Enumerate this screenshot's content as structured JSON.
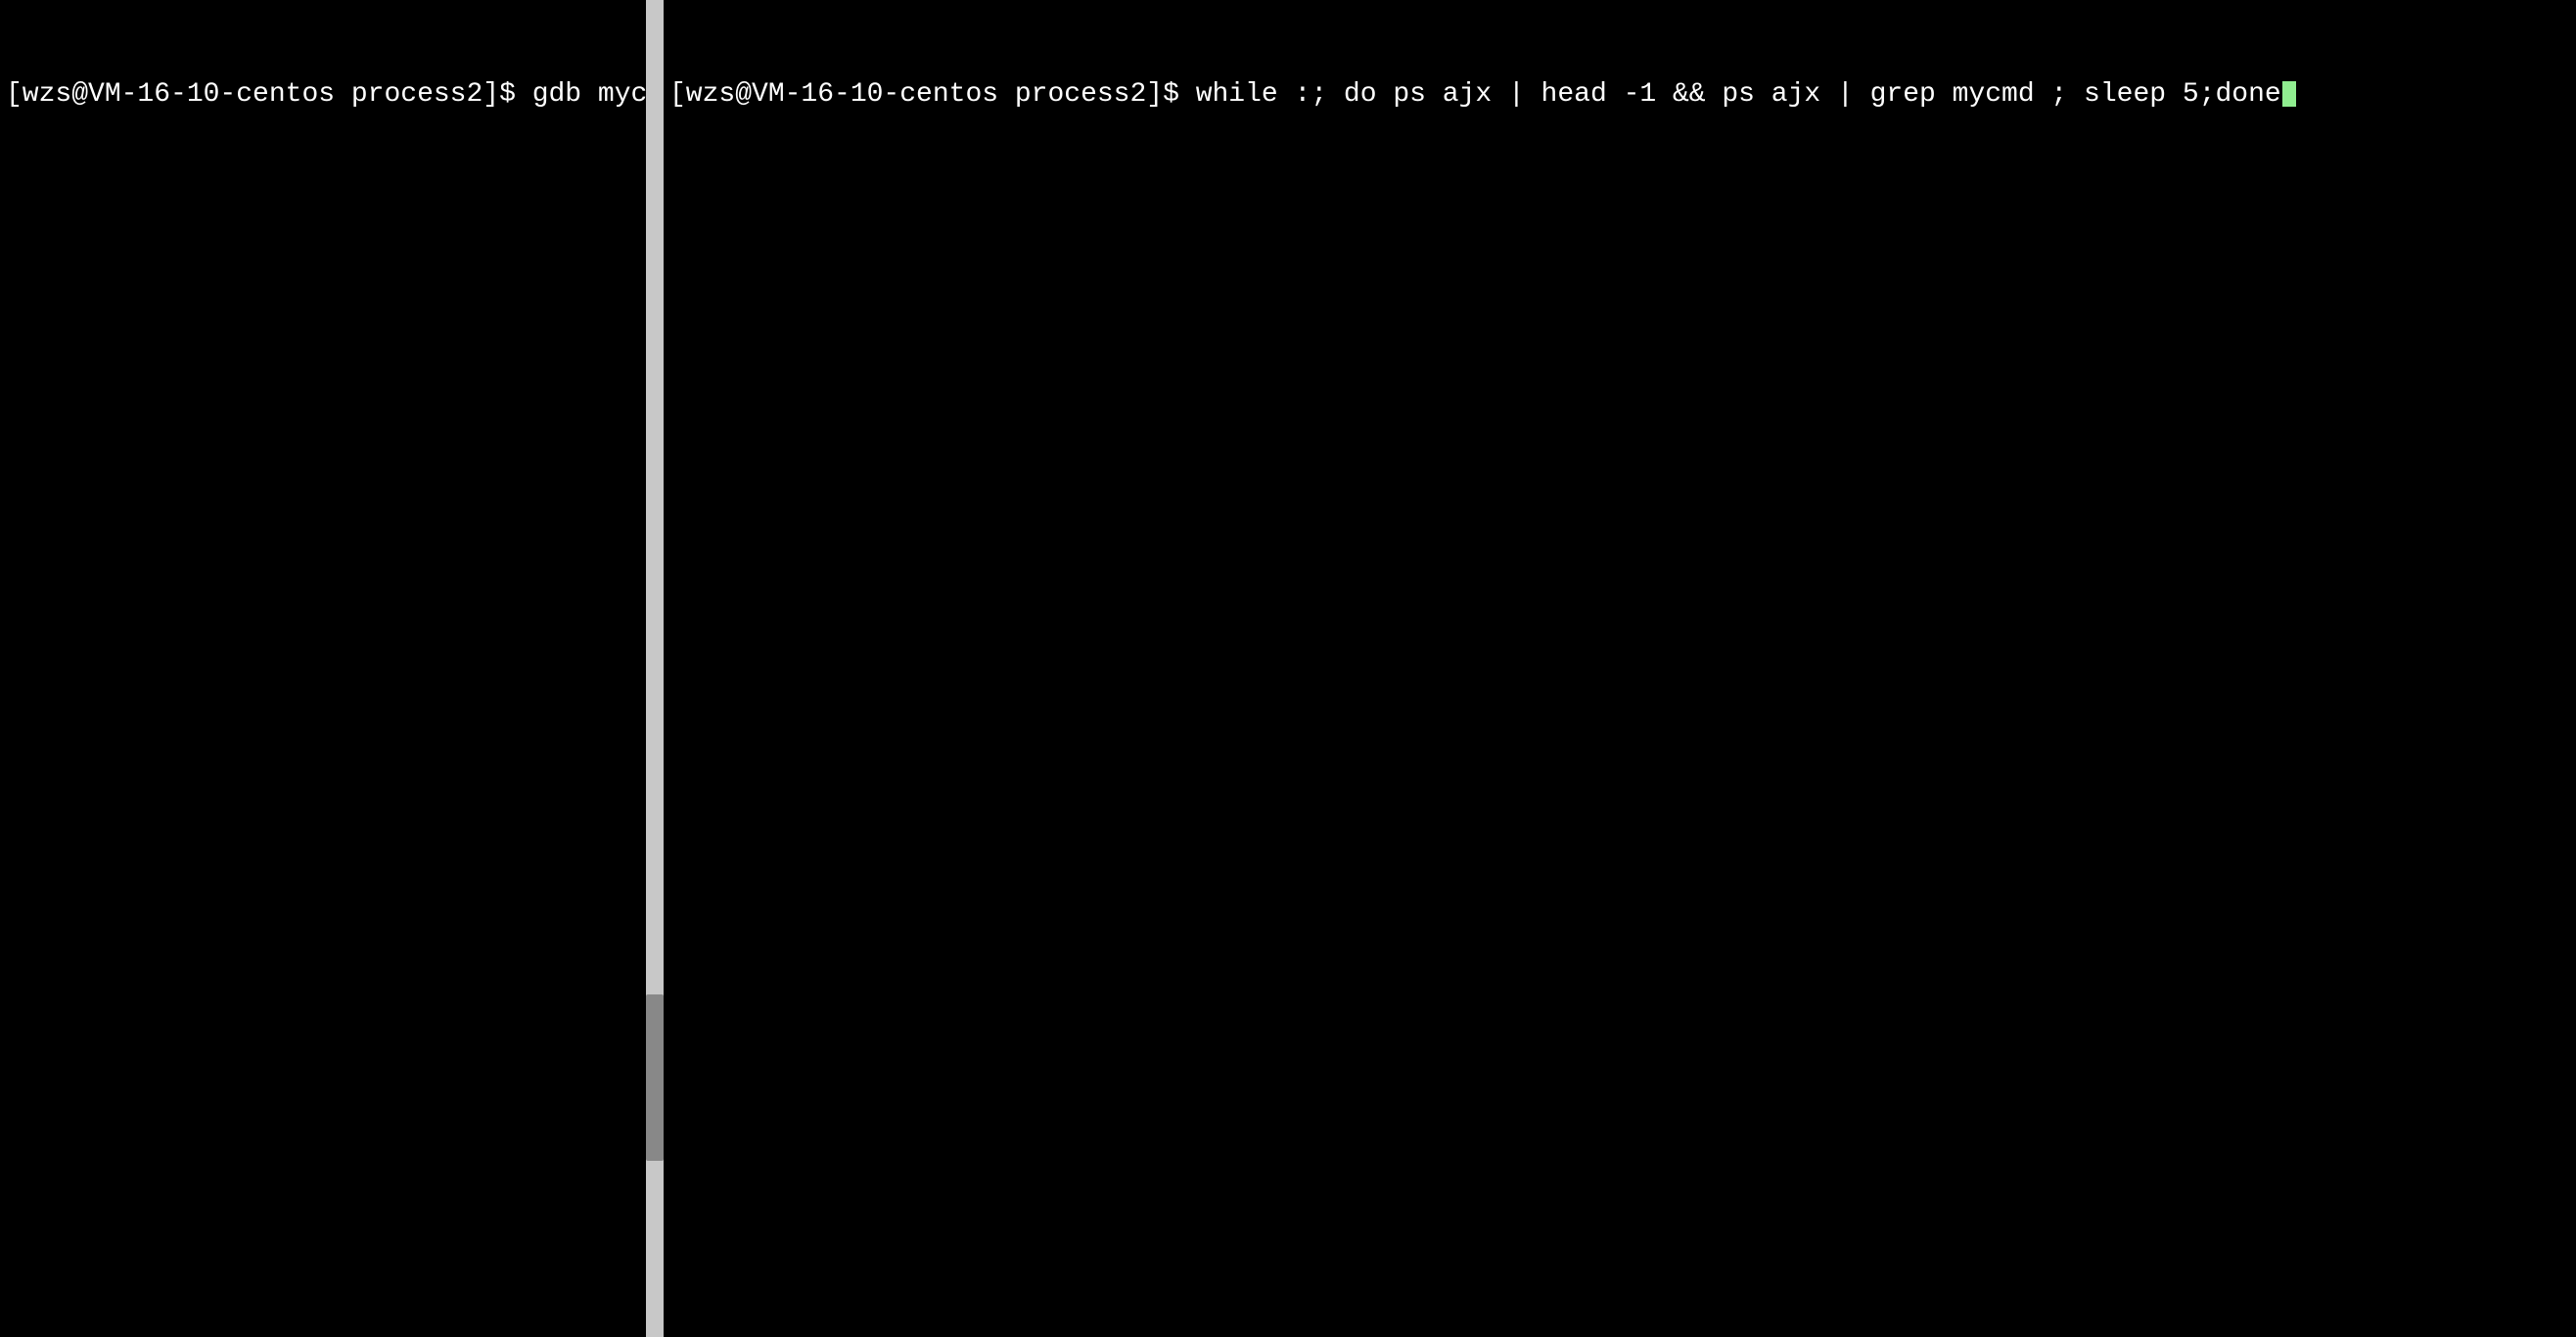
{
  "left_pane": {
    "prompt": "[wzs@VM-16-10-centos process2]$",
    "command": " gdb mycmd",
    "cursor": true
  },
  "right_pane": {
    "prompt": "[wzs@VM-16-10-centos process2]$",
    "command": " while :; do ps ajx | head -1 && ps ajx | grep mycmd ; sleep 5;done",
    "cursor": true
  },
  "divider": {
    "scrollbar_present": true
  }
}
